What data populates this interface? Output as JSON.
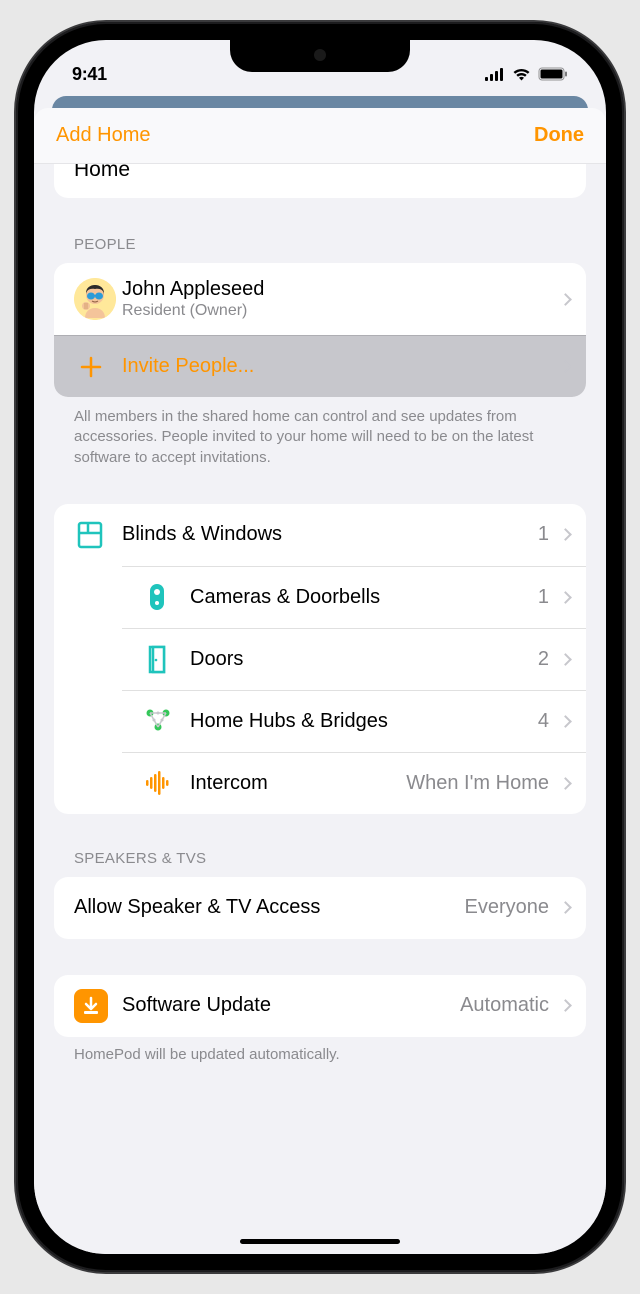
{
  "status": {
    "time": "9:41"
  },
  "nav": {
    "left": "Add Home",
    "right": "Done"
  },
  "home_card": {
    "title": "Home"
  },
  "people": {
    "header": "PEOPLE",
    "owner": {
      "name": "John Appleseed",
      "role": "Resident (Owner)"
    },
    "invite": "Invite People...",
    "footer": "All members in the shared home can control and see updates from accessories. People invited to your home will need to be on the latest software to accept invitations."
  },
  "accessories": [
    {
      "label": "Blinds & Windows",
      "value": "1"
    },
    {
      "label": "Cameras & Doorbells",
      "value": "1"
    },
    {
      "label": "Doors",
      "value": "2"
    },
    {
      "label": "Home Hubs & Bridges",
      "value": "4"
    },
    {
      "label": "Intercom",
      "value": "When I'm Home"
    }
  ],
  "speakers": {
    "header": "SPEAKERS & TVS",
    "row": {
      "label": "Allow Speaker & TV Access",
      "value": "Everyone"
    }
  },
  "software": {
    "label": "Software Update",
    "value": "Automatic",
    "footer": "HomePod will be updated automatically."
  }
}
